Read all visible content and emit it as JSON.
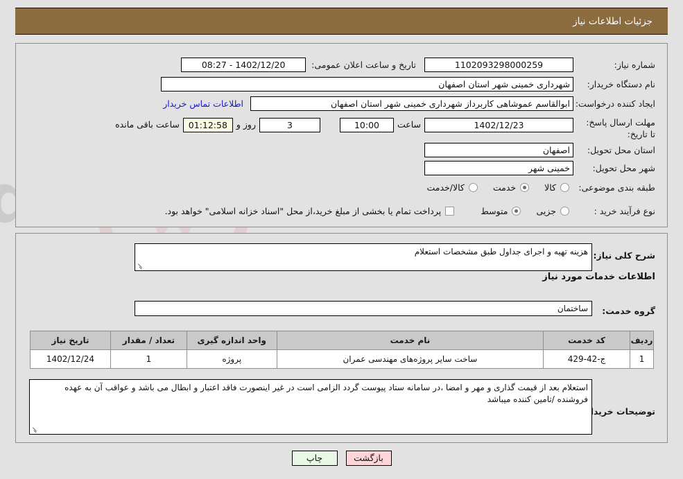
{
  "header": {
    "title": "جزئیات اطلاعات نیاز"
  },
  "fields": {
    "need_number_label": "شماره نیاز:",
    "need_number_value": "1102093298000259",
    "public_announce_label": "تاریخ و ساعت اعلان عمومی:",
    "public_announce_value": "1402/12/20 - 08:27",
    "buyer_org_label": "نام دستگاه خریدار:",
    "buyer_org_value": "شهرداری خمینی شهر استان اصفهان",
    "requester_label": "ایجاد کننده درخواست:",
    "requester_value": "ابوالقاسم عموشاهی کاربرداز شهرداری خمینی شهر استان اصفهان",
    "contact_link": "اطلاعات تماس خریدار",
    "deadline_label": "مهلت ارسال پاسخ: تا تاریخ:",
    "deadline_date": "1402/12/23",
    "deadline_hour_label": "ساعت",
    "deadline_hour_value": "10:00",
    "remaining_days_value": "3",
    "remaining_days_label": "روز و",
    "remaining_time_value": "01:12:58",
    "remaining_time_label": "ساعت باقی مانده",
    "province_label": "استان محل تحویل:",
    "province_value": "اصفهان",
    "city_label": "شهر محل تحویل:",
    "city_value": "خمینی شهر",
    "classification_label": "طبقه بندی موضوعی:",
    "classification_options": [
      {
        "label": "کالا",
        "selected": false
      },
      {
        "label": "خدمت",
        "selected": true
      },
      {
        "label": "کالا/خدمت",
        "selected": false
      }
    ],
    "process_type_label": "نوع فرآیند خرید :",
    "process_type_options": [
      {
        "label": "جزیی",
        "selected": false
      },
      {
        "label": "متوسط",
        "selected": true
      }
    ],
    "treasury_checkbox_label": "پرداخت تمام یا بخشی از مبلغ خرید،از محل \"اسناد خزانه اسلامی\" خواهد بود.",
    "treasury_checkbox_checked": false
  },
  "need_summary": {
    "label": "شرح کلی نیاز:",
    "value": "هزینه تهیه و اجرای جداول طبق مشخصات استعلام"
  },
  "services_section": {
    "heading": "اطلاعات خدمات مورد نیاز",
    "group_label": "گروه خدمت:",
    "group_value": "ساختمان"
  },
  "table": {
    "columns": [
      "ردیف",
      "کد خدمت",
      "نام خدمت",
      "واحد اندازه گیری",
      "تعداد / مقدار",
      "تاریخ نیاز"
    ],
    "rows": [
      {
        "radif": "1",
        "code": "ج-42-429",
        "name": "ساخت سایر پروژه‌های مهندسی عمران",
        "unit": "پروژه",
        "qty": "1",
        "date": "1402/12/24"
      }
    ]
  },
  "buyer_notes": {
    "label": "توضیحات خریدار:",
    "value": "استعلام بعد از قیمت گذاری و مهر و امضا ،در سامانه ستاد پیوست گردد الزامی است در غیر اینصورت فاقد اعتبار و ابطال می باشد و عواقب آن به عهده فروشنده /تامین کننده میباشد"
  },
  "footer": {
    "back_label": "بازگشت",
    "print_label": "چاپ"
  },
  "watermark": {
    "text": "AriaTender.net"
  },
  "colors": {
    "header_bg": "#8a6c3f",
    "page_bg": "#e2e2e2",
    "link": "#1717cf",
    "table_header_bg": "#c9c9c9",
    "back_btn": "#fdd5d8",
    "print_btn": "#e8f8e4",
    "countdown_bg": "#fbfbe4"
  }
}
